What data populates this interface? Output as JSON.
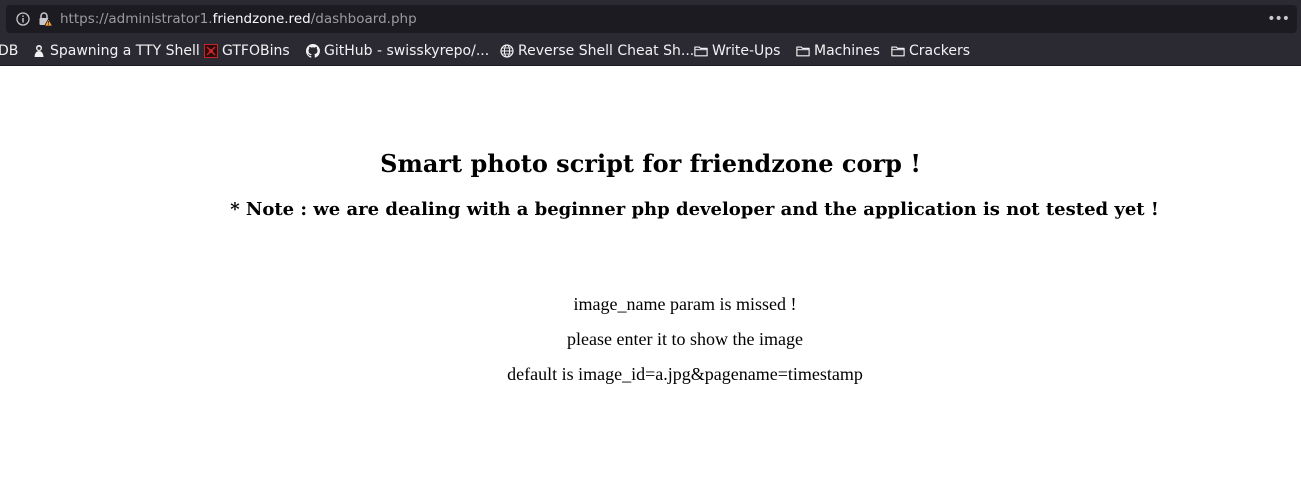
{
  "browser": {
    "url_prefix": "https://administrator1.",
    "url_host": "friendzone.red",
    "url_path": "/dashboard.php",
    "menu_label": "•••"
  },
  "bookmarks": [
    {
      "label": "DB",
      "icon": "none"
    },
    {
      "label": "Spawning a TTY Shell",
      "icon": "hooded-figure-icon"
    },
    {
      "label": "GTFOBins",
      "icon": "gtfobins-icon"
    },
    {
      "label": "GitHub - swisskyrepo/...",
      "icon": "github-icon"
    },
    {
      "label": "Reverse Shell Cheat Sh...",
      "icon": "globe-icon"
    },
    {
      "label": "Write-Ups",
      "icon": "folder-icon"
    },
    {
      "label": "Machines",
      "icon": "folder-icon"
    },
    {
      "label": "Crackers",
      "icon": "folder-icon"
    }
  ],
  "page": {
    "title": "Smart photo script for friendzone corp !",
    "note": "* Note : we are dealing with a beginner php developer and the application is not tested yet !",
    "lines": [
      "image_name param is missed !",
      "please enter it to show the image",
      "default is image_id=a.jpg&pagename=timestamp"
    ]
  },
  "colors": {
    "chrome_bg": "#2b2a33",
    "url_field_bg": "#1c1b22",
    "page_bg": "#ffffff",
    "warning": "#ffa436"
  }
}
